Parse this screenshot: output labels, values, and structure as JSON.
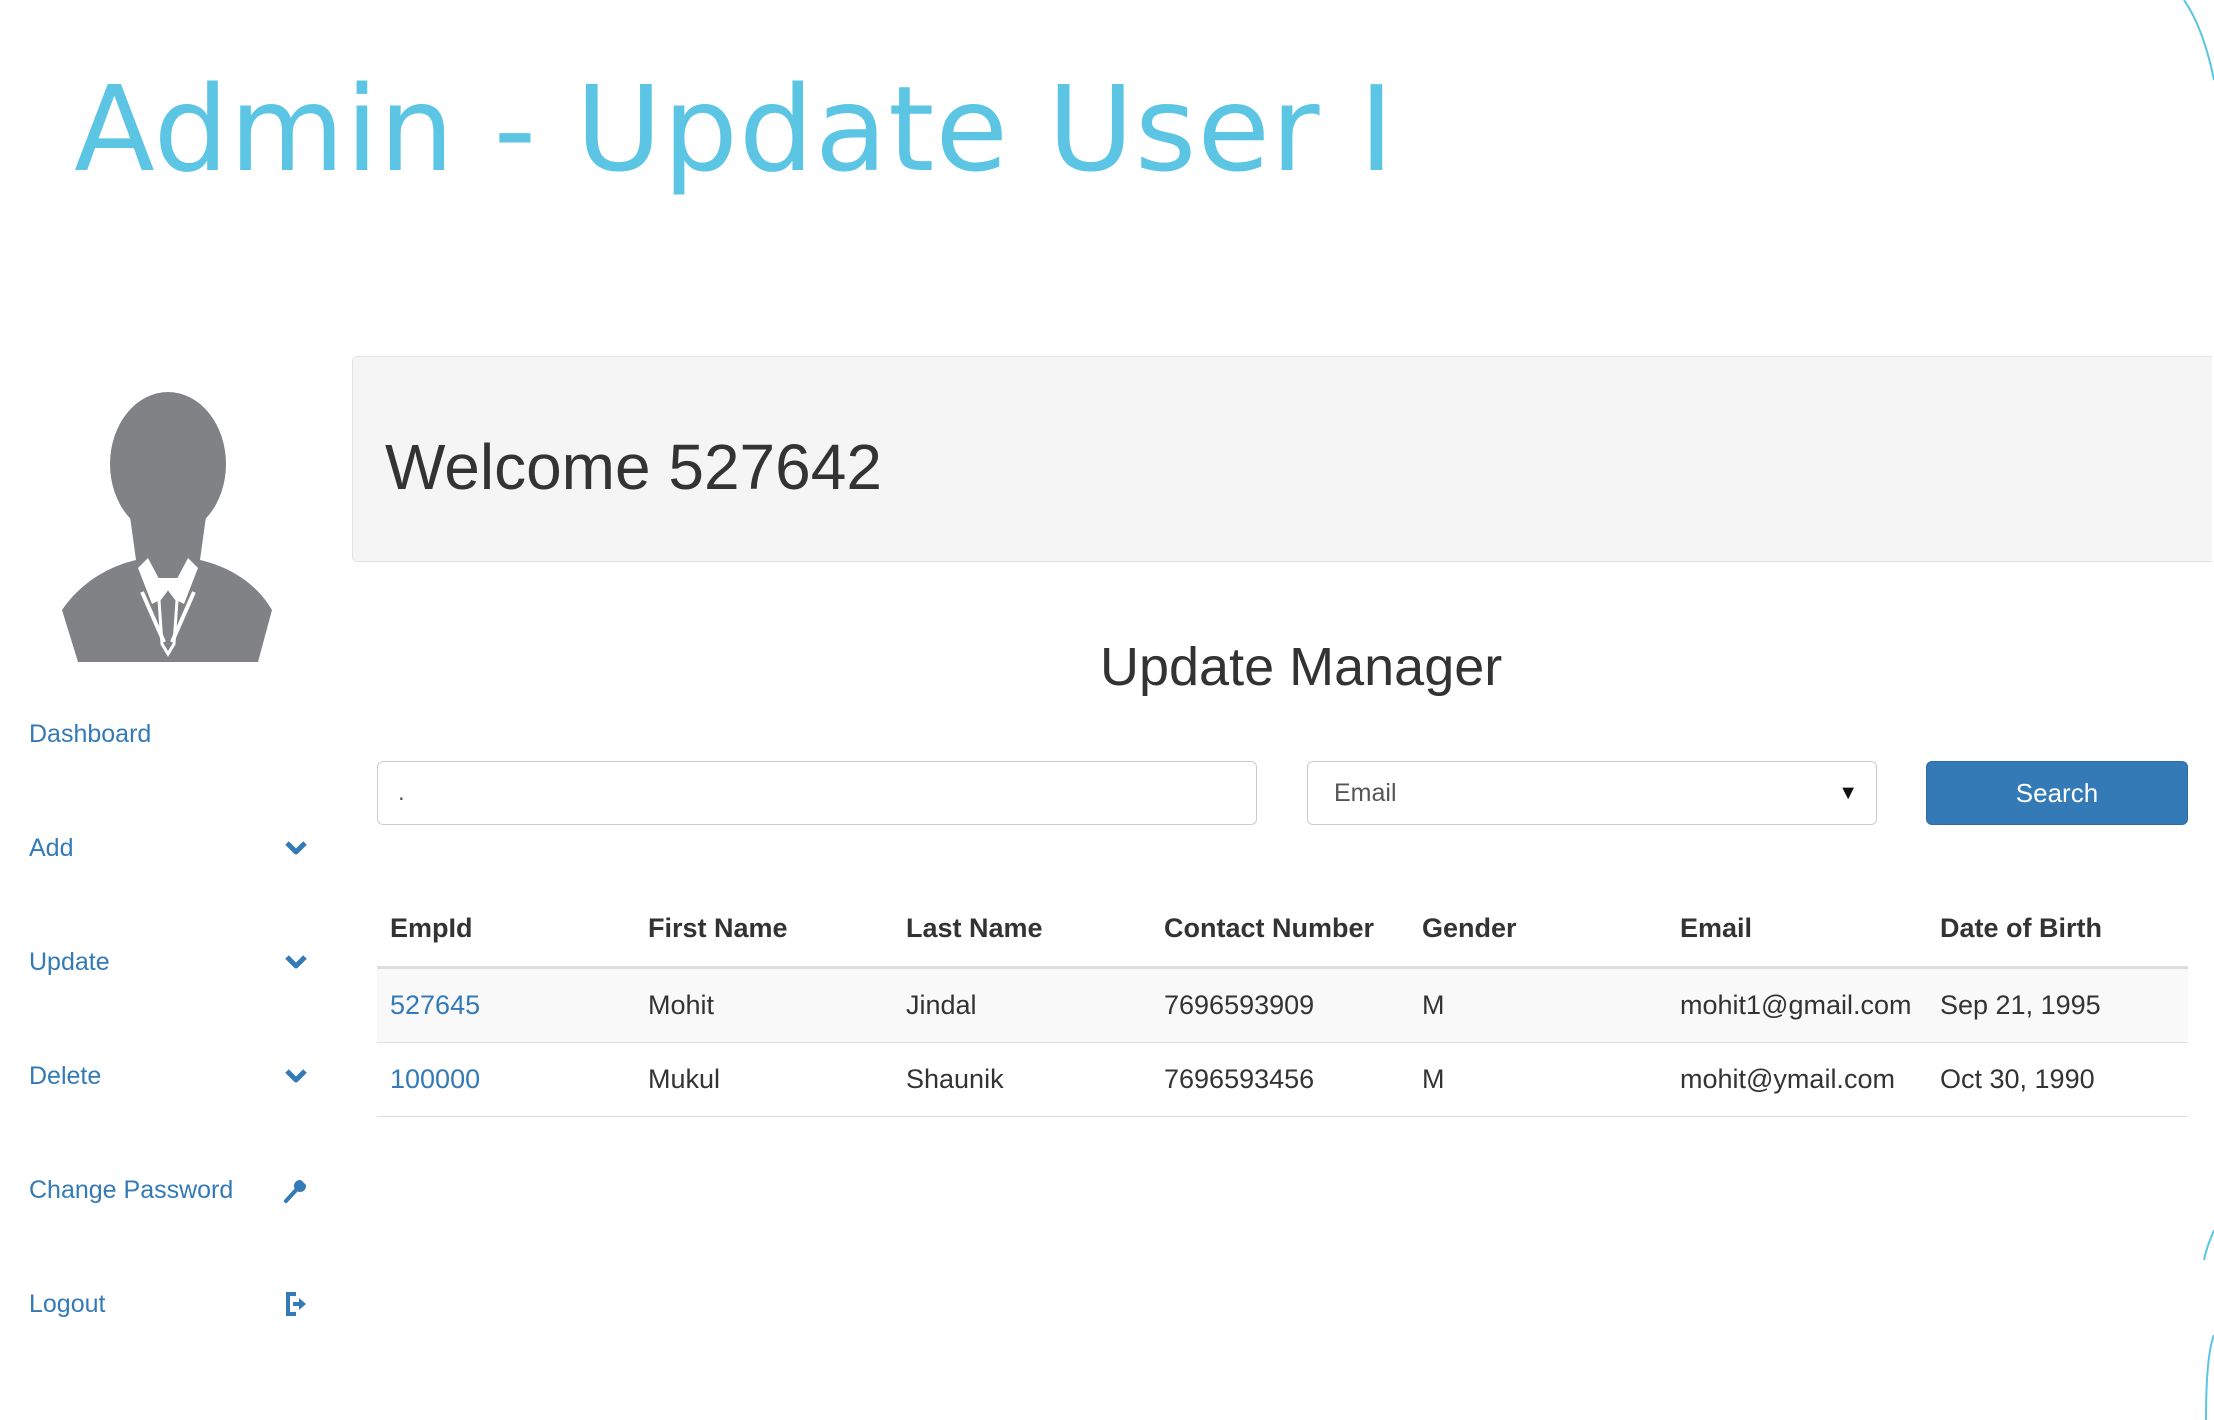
{
  "slide": {
    "title": "Admin - Update User I"
  },
  "sidebar": {
    "avatar_icon": "user-silhouette-icon",
    "items": [
      {
        "label": "Dashboard",
        "icon": ""
      },
      {
        "label": "Add",
        "icon": "chevron-down-icon"
      },
      {
        "label": "Update",
        "icon": "chevron-down-icon"
      },
      {
        "label": "Delete",
        "icon": "chevron-down-icon"
      },
      {
        "label": "Change Password",
        "icon": "wrench-icon"
      },
      {
        "label": "Logout",
        "icon": "logout-icon"
      }
    ]
  },
  "header": {
    "welcome": "Welcome 527642"
  },
  "main": {
    "title": "Update Manager",
    "search": {
      "value": ".",
      "placeholder": ""
    },
    "filter": {
      "selected": "Email"
    },
    "search_button": "Search",
    "table": {
      "columns": [
        "EmpId",
        "First Name",
        "Last Name",
        "Contact Number",
        "Gender",
        "Email",
        "Date of Birth"
      ],
      "rows": [
        [
          "527645",
          "Mohit",
          "Jindal",
          "7696593909",
          "M",
          "mohit1@gmail.com",
          "Sep 21, 1995"
        ],
        [
          "100000",
          "Mukul",
          "Shaunik",
          "7696593456",
          "M",
          "mohit@ymail.com",
          "Oct 30, 1990"
        ]
      ]
    }
  },
  "colors": {
    "title": "#5bc5e3",
    "link": "#337ab7",
    "button": "#337ab7",
    "panel": "#f5f5f5",
    "avatar": "#808285"
  }
}
